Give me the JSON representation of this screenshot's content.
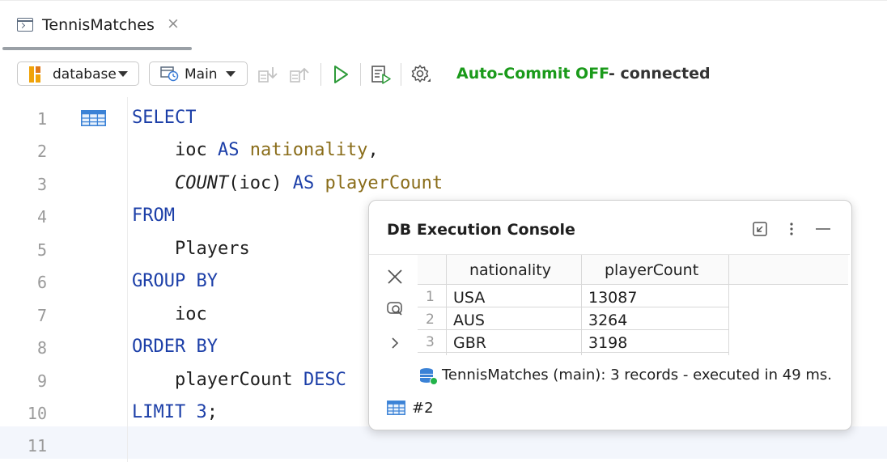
{
  "tab": {
    "title": "TennisMatches",
    "close": "×"
  },
  "toolbar": {
    "database_label": "database",
    "schema_label": "Main",
    "auto_commit": "Auto-Commit OFF",
    "connection": "- connected",
    "colors": {
      "commit": "#1a9a1a"
    }
  },
  "editor": {
    "line_numbers": [
      "1",
      "2",
      "3",
      "4",
      "5",
      "6",
      "7",
      "8",
      "9",
      "10",
      "11"
    ],
    "lines": [
      "SELECT",
      "    ioc AS nationality,",
      "    COUNT(ioc) AS playerCount",
      "FROM",
      "    Players",
      "GROUP BY",
      "    ioc",
      "ORDER BY",
      "    playerCount DESC",
      "LIMIT 3;",
      ""
    ],
    "tokens": {
      "select": "SELECT",
      "ioc": "ioc",
      "as": "AS",
      "nationality": "nationality",
      "comma": ",",
      "count": "COUNT",
      "count_arg": "(ioc)",
      "playercount": "playerCount",
      "from": "FROM",
      "players": "Players",
      "group_by": "GROUP BY",
      "order_by": "ORDER BY",
      "desc": "DESC",
      "limit": "LIMIT",
      "three": "3",
      "semi": ";"
    }
  },
  "console": {
    "title": "DB Execution Console",
    "columns": [
      "nationality",
      "playerCount"
    ],
    "rows": [
      {
        "n": "1",
        "nationality": "USA",
        "playerCount": "13087"
      },
      {
        "n": "2",
        "nationality": "AUS",
        "playerCount": "3264"
      },
      {
        "n": "3",
        "nationality": "GBR",
        "playerCount": "3198"
      }
    ],
    "result": "TennisMatches (main): 3 records  - executed in 49 ms.",
    "run_tag": "#2"
  }
}
